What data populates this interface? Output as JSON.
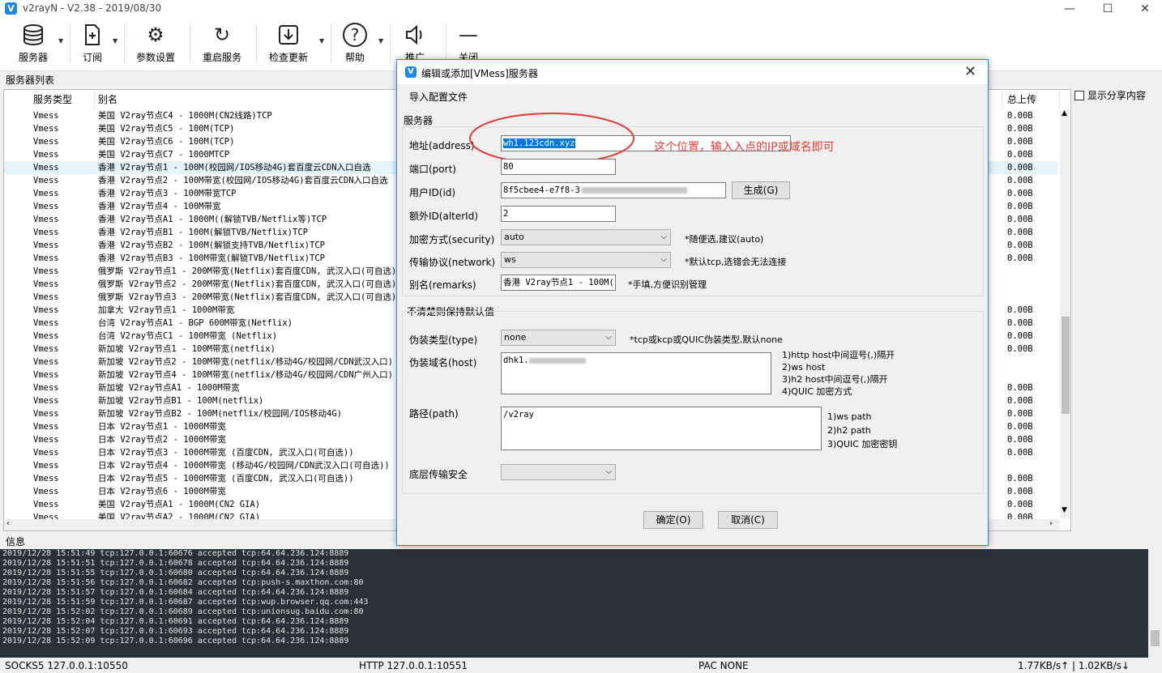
{
  "window": {
    "title": "v2rayN - V2.38 - 2019/08/30",
    "logo": "V",
    "min": "—",
    "max": "☐",
    "close": "✕"
  },
  "toolbar": {
    "servers": "服务器",
    "subscribe": "订阅",
    "settings": "参数设置",
    "restart": "重启服务",
    "update": "检查更新",
    "help": "帮助",
    "promote": "推广",
    "close": "关闭"
  },
  "server_list": {
    "title": "服务器列表",
    "col_type": "服务类型",
    "col_name": "别名",
    "col_up": "总上传",
    "share_label": "显示分享内容",
    "rows": [
      {
        "type": "Vmess",
        "name": "美国 V2ray节点C4 - 1000M(CN2线路)TCP",
        "up": "0.00B"
      },
      {
        "type": "Vmess",
        "name": "美国 V2ray节点C5 - 100M(TCP)",
        "up": "0.00B"
      },
      {
        "type": "Vmess",
        "name": "美国 V2ray节点C6 - 100M(TCP)",
        "up": "0.00B"
      },
      {
        "type": "Vmess",
        "name": "美国 V2ray节点C7 - 1000MTCP",
        "up": "0.00B"
      },
      {
        "type": "Vmess",
        "name": "香港 V2ray节点1 - 100M(校园网/IOS移动4G)套百度云CDN入口自选",
        "up": "0.00B"
      },
      {
        "type": "Vmess",
        "name": "香港 V2ray节点2 - 100M带宽(校园网/IOS移动4G)套百度云CDN入口自选",
        "up": "0.00B"
      },
      {
        "type": "Vmess",
        "name": "香港 V2ray节点3 - 100M带宽TCP",
        "up": "0.00B"
      },
      {
        "type": "Vmess",
        "name": "香港 V2ray节点4 - 100M带宽",
        "up": "0.00B"
      },
      {
        "type": "Vmess",
        "name": "香港 V2ray节点A1 - 1000M((解锁TVB/Netflix等)TCP",
        "up": "0.00B"
      },
      {
        "type": "Vmess",
        "name": "香港 V2ray节点B1 - 100M(解锁TVB/Netflix)TCP",
        "up": "0.00B"
      },
      {
        "type": "Vmess",
        "name": "香港 V2ray节点B2 - 100M(解锁支持TVB/Netflix)TCP",
        "up": "0.00B"
      },
      {
        "type": "Vmess",
        "name": "香港 V2ray节点B3 - 100M带宽(解锁TVB/Netflix)TCP",
        "up": "0.00B"
      },
      {
        "type": "Vmess",
        "name": "俄罗斯 V2ray节点1 - 200M带宽(Netflix)套百度CDN, 武汉入口(可自选)",
        "up": ""
      },
      {
        "type": "Vmess",
        "name": "俄罗斯 V2ray节点2 - 200M带宽(Netflix)套百度CDN, 武汉入口(可自选)",
        "up": ""
      },
      {
        "type": "Vmess",
        "name": "俄罗斯 V2ray节点3 - 200M带宽(Netflix)套百度CDN, 武汉入口(可自选)",
        "up": ""
      },
      {
        "type": "Vmess",
        "name": "加拿大 V2ray节点1 - 1000M带宽",
        "up": "0.00B"
      },
      {
        "type": "Vmess",
        "name": "台湾 V2ray节点A1 - BGP  600M带宽(Netflix)",
        "up": "0.00B"
      },
      {
        "type": "Vmess",
        "name": "台湾 V2ray节点C1 - 100M带宽 (Netflix)",
        "up": "0.00B"
      },
      {
        "type": "Vmess",
        "name": "新加坡 V2ray节点1 - 100M带宽(netflix)",
        "up": "0.00B"
      },
      {
        "type": "Vmess",
        "name": "新加坡 V2ray节点2 - 100M带宽(netflix/移动4G/校园网/CDN武汉入口)",
        "up": ""
      },
      {
        "type": "Vmess",
        "name": "新加坡 V2ray节点4 - 100M带宽(netflix/移动4G/校园网/CDN广州入口)",
        "up": ""
      },
      {
        "type": "Vmess",
        "name": "新加坡 V2ray节点A1 - 1000M带宽",
        "up": "0.00B"
      },
      {
        "type": "Vmess",
        "name": "新加坡 V2ray节点B1 - 100M(netflix)",
        "up": "0.00B"
      },
      {
        "type": "Vmess",
        "name": "新加坡 V2ray节点B2 - 100M(netflix/校园网/IOS移动4G)",
        "up": "0.00B"
      },
      {
        "type": "Vmess",
        "name": "日本 V2ray节点1 - 1000M带宽",
        "up": "0.00B"
      },
      {
        "type": "Vmess",
        "name": "日本 V2ray节点2 - 1000M带宽",
        "up": "0.00B"
      },
      {
        "type": "Vmess",
        "name": "日本 V2ray节点3 - 1000M带宽 (百度CDN, 武汉入口(可自选))",
        "up": "0.00B"
      },
      {
        "type": "Vmess",
        "name": "日本 V2ray节点4 - 1000M带宽 (移动4G/校园网/CDN武汉入口(可自选))",
        "up": ""
      },
      {
        "type": "Vmess",
        "name": "日本 V2ray节点5 - 1000M带宽 (百度CDN, 武汉入口(可自选))",
        "up": "0.00B"
      },
      {
        "type": "Vmess",
        "name": "日本 V2ray节点6 - 1000M带宽",
        "up": "0.00B"
      },
      {
        "type": "Vmess",
        "name": "美国 V2ray节点A1 - 1000M(CN2 GIA)",
        "up": "0.00B"
      },
      {
        "type": "Vmess",
        "name": "美国 V2ray节点A2 - 1000M(CN2 GIA)",
        "up": "0.00B"
      }
    ],
    "extra_up": [
      "0.00B",
      "0.00B",
      "0.00B",
      "0.00B",
      "0.00B",
      "0.00B"
    ]
  },
  "info": {
    "title": "信息",
    "log": [
      "2019/12/28 15:51:49 tcp:127.0.0.1:60676 accepted tcp:64.64.236.124:8889",
      "2019/12/28 15:51:51 tcp:127.0.0.1:60678 accepted tcp:64.64.236.124:8889",
      "2019/12/28 15:51:55 tcp:127.0.0.1:60680 accepted tcp:64.64.236.124:8889",
      "2019/12/28 15:51:56 tcp:127.0.0.1:60682 accepted tcp:push-s.maxthon.com:80",
      "2019/12/28 15:51:57 tcp:127.0.0.1:60684 accepted tcp:64.64.236.124:8889",
      "2019/12/28 15:51:59 tcp:127.0.0.1:60687 accepted tcp:wup.browser.qq.com:443",
      "2019/12/28 15:52:02 tcp:127.0.0.1:60689 accepted tcp:unionsug.baidu.com:80",
      "2019/12/28 15:52:04 tcp:127.0.0.1:60691 accepted tcp:64.64.236.124:8889",
      "2019/12/28 15:52:07 tcp:127.0.0.1:60693 accepted tcp:64.64.236.124:8889",
      "2019/12/28 15:52:09 tcp:127.0.0.1:60696 accepted tcp:64.64.236.124:8889"
    ]
  },
  "status": {
    "socks": "SOCKS5  127.0.0.1:10550",
    "http": "HTTP  127.0.0.1:10551",
    "pac": "PAC  NONE",
    "speed": "1.77KB/s↑ | 1.02KB/s↓"
  },
  "dialog": {
    "title": "编辑或添加[VMess]服务器",
    "import_menu": "导入配置文件",
    "server_group": "服务器",
    "address_label": "地址(address)",
    "address_value": "wh1.123cdn.xyz",
    "annotation": "这个位置，输入入点的IP或域名即可",
    "port_label": "端口(port)",
    "port_value": "80",
    "id_label": "用户ID(id)",
    "id_value": "8f5cbee4-e7f8-3",
    "generate": "生成(G)",
    "alterid_label": "额外ID(alterId)",
    "alterid_value": "2",
    "security_label": "加密方式(security)",
    "security_value": "auto",
    "security_note": "*随便选,建议(auto)",
    "network_label": "传输协议(network)",
    "network_value": "ws",
    "network_note": "*默认tcp,选错会无法连接",
    "remarks_label": "别名(remarks)",
    "remarks_value": "香港 V2ray节点1 - 100M(",
    "remarks_note": "*手填,方便识别管理",
    "default_group": "不清楚则保持默认值",
    "type_label": "伪装类型(type)",
    "type_value": "none",
    "type_note": "*tcp或kcp或QUIC伪装类型,默认none",
    "host_label": "伪装域名(host)",
    "host_value": "dhk1.",
    "host_notes": [
      "1)http host中间逗号(,)隔开",
      "2)ws host",
      "3)h2 host中间逗号(,)隔开",
      "4)QUIC 加密方式"
    ],
    "path_label": "路径(path)",
    "path_value": "/v2ray",
    "path_notes": [
      "1)ws path",
      "2)h2 path",
      "3)QUIC 加密密钥"
    ],
    "tls_label": "底层传输安全",
    "tls_value": "",
    "ok": "确定(O)",
    "cancel": "取消(C)"
  },
  "colors": {
    "accent": "#1e88e5",
    "annotation": "#e53935",
    "log_bg": "#263238"
  },
  "icons": [
    "database-icon",
    "subscribe-icon",
    "gear-icon",
    "restart-icon",
    "download-icon",
    "help-icon",
    "speaker-icon",
    "minus-icon"
  ]
}
